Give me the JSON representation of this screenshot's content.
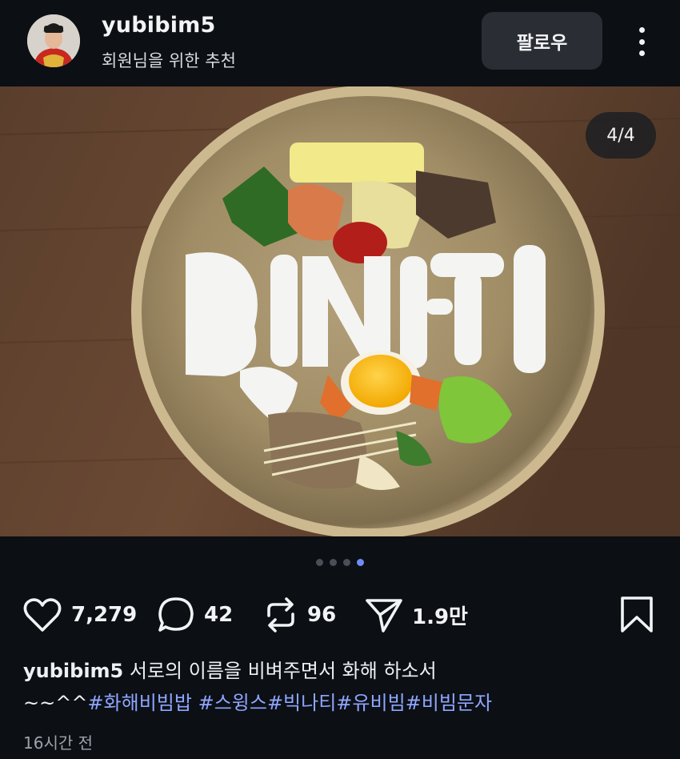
{
  "header": {
    "username": "yubibim5",
    "subtitle": "회원님을 위한 추천",
    "follow_label": "팔로우"
  },
  "photo": {
    "counter": "4/4",
    "total_images": 4,
    "current_index": 4
  },
  "actions": {
    "likes": "7,279",
    "comments": "42",
    "reposts": "96",
    "shares": "1.9만"
  },
  "caption": {
    "username": "yubibim5",
    "text_line1": "서로의 이름을 비벼주면서 화해 하소서",
    "text_prefix": "~~^^",
    "hashtags": [
      "#화해비빔밥",
      " #스윙스",
      "#빅나티",
      "#유비빔",
      "#비빔문자"
    ]
  },
  "timestamp": "16시간 전",
  "colors": {
    "background": "#0c0f14",
    "accent": "#8ea6ff",
    "active_dot": "#6f8cf6"
  },
  "icons": {
    "more": "more-vertical-icon",
    "like": "heart-icon",
    "comment": "comment-icon",
    "repost": "repost-icon",
    "share": "send-icon",
    "save": "bookmark-icon"
  }
}
